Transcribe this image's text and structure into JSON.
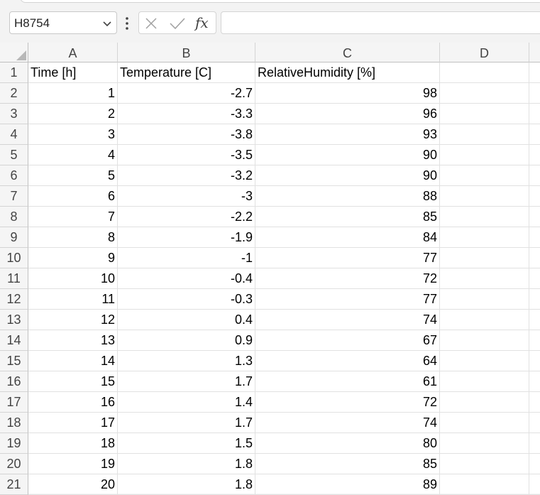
{
  "formula_bar": {
    "name_box": "H8754",
    "formula": "",
    "cancel_icon": "close-icon",
    "enter_icon": "checkmark-icon",
    "fx_label": "fx"
  },
  "columns": [
    "A",
    "B",
    "C",
    "D"
  ],
  "header_row": {
    "row_number": "1",
    "a": "Time [h]",
    "b": "Temperature [C]",
    "c": "RelativeHumidity [%]",
    "d": ""
  },
  "rows": [
    {
      "row_number": "2",
      "a": "1",
      "b": "-2.7",
      "c": "98",
      "d": ""
    },
    {
      "row_number": "3",
      "a": "2",
      "b": "-3.3",
      "c": "96",
      "d": ""
    },
    {
      "row_number": "4",
      "a": "3",
      "b": "-3.8",
      "c": "93",
      "d": ""
    },
    {
      "row_number": "5",
      "a": "4",
      "b": "-3.5",
      "c": "90",
      "d": ""
    },
    {
      "row_number": "6",
      "a": "5",
      "b": "-3.2",
      "c": "90",
      "d": ""
    },
    {
      "row_number": "7",
      "a": "6",
      "b": "-3",
      "c": "88",
      "d": ""
    },
    {
      "row_number": "8",
      "a": "7",
      "b": "-2.2",
      "c": "85",
      "d": ""
    },
    {
      "row_number": "9",
      "a": "8",
      "b": "-1.9",
      "c": "84",
      "d": ""
    },
    {
      "row_number": "10",
      "a": "9",
      "b": "-1",
      "c": "77",
      "d": ""
    },
    {
      "row_number": "11",
      "a": "10",
      "b": "-0.4",
      "c": "72",
      "d": ""
    },
    {
      "row_number": "12",
      "a": "11",
      "b": "-0.3",
      "c": "77",
      "d": ""
    },
    {
      "row_number": "13",
      "a": "12",
      "b": "0.4",
      "c": "74",
      "d": ""
    },
    {
      "row_number": "14",
      "a": "13",
      "b": "0.9",
      "c": "67",
      "d": ""
    },
    {
      "row_number": "15",
      "a": "14",
      "b": "1.3",
      "c": "64",
      "d": ""
    },
    {
      "row_number": "16",
      "a": "15",
      "b": "1.7",
      "c": "61",
      "d": ""
    },
    {
      "row_number": "17",
      "a": "16",
      "b": "1.4",
      "c": "72",
      "d": ""
    },
    {
      "row_number": "18",
      "a": "17",
      "b": "1.7",
      "c": "74",
      "d": ""
    },
    {
      "row_number": "19",
      "a": "18",
      "b": "1.5",
      "c": "80",
      "d": ""
    },
    {
      "row_number": "20",
      "a": "19",
      "b": "1.8",
      "c": "85",
      "d": ""
    },
    {
      "row_number": "21",
      "a": "20",
      "b": "1.8",
      "c": "89",
      "d": ""
    }
  ]
}
